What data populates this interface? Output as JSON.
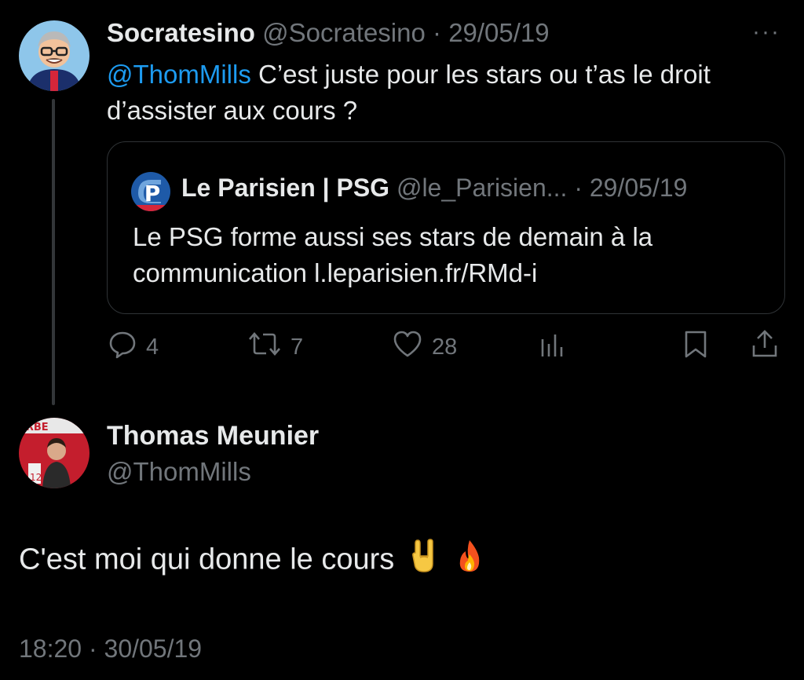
{
  "reply_tweet": {
    "display_name": "Socratesino",
    "handle": "@Socratesino",
    "separator": "·",
    "date": "29/05/19",
    "more_label": "···",
    "mention": "@ThomMills",
    "text": " C’est juste pour les stars ou t’as le droit d’assister aux cours ?",
    "quoted": {
      "display_name": "Le Parisien | PSG",
      "handle": "@le_Parisien...",
      "separator": "·",
      "date": "29/05/19",
      "text": "Le PSG forme aussi ses stars de demain à la communication l.leparisien.fr/RMd-i"
    },
    "actions": {
      "replies": "4",
      "retweets": "7",
      "likes": "28"
    }
  },
  "main_tweet": {
    "display_name": "Thomas Meunier",
    "handle": "@ThomMills",
    "text": "C'est moi qui donne le cours",
    "emojis": [
      "sign-of-horns",
      "fire"
    ],
    "time": "18:20",
    "separator": "·",
    "date": "30/05/19"
  },
  "colors": {
    "background": "#000000",
    "text": "#e7e9ea",
    "muted": "#71767b",
    "link": "#1d9bf0",
    "border": "#2f3336"
  }
}
